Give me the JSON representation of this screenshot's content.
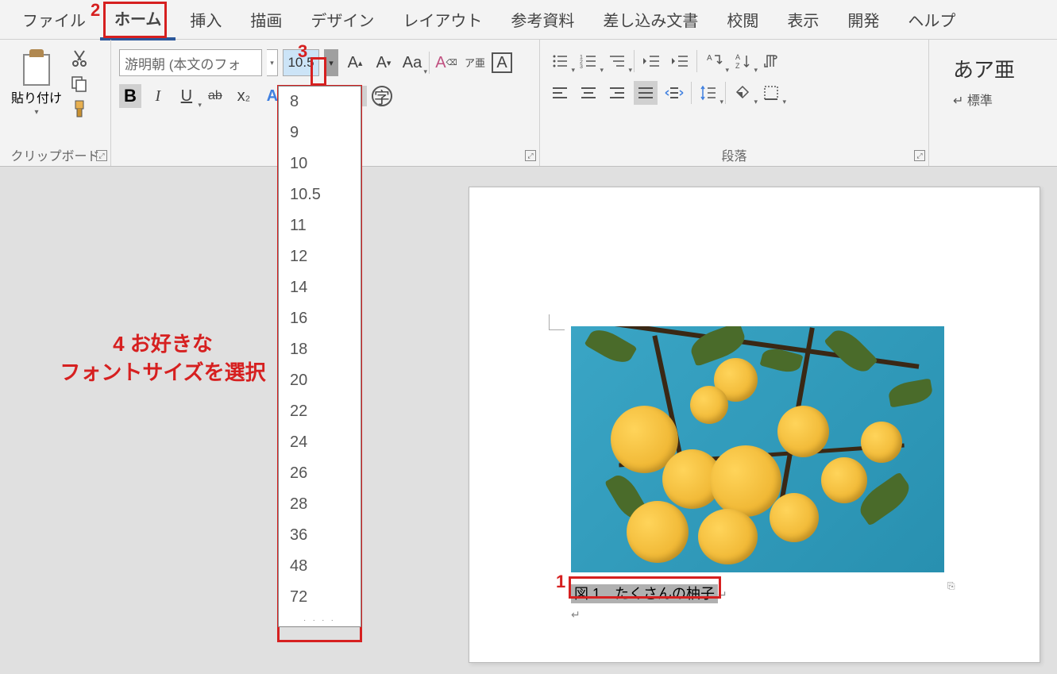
{
  "menu": {
    "items": [
      "ファイル",
      "ホーム",
      "挿入",
      "描画",
      "デザイン",
      "レイアウト",
      "参考資料",
      "差し込み文書",
      "校閲",
      "表示",
      "開発",
      "ヘルプ"
    ],
    "active_index": 1
  },
  "ribbon": {
    "clipboard": {
      "paste": "貼り付け",
      "group_label": "クリップボード"
    },
    "font": {
      "name": "游明朝 (本文のフォ",
      "size": "10.5",
      "bold": "B",
      "italic": "I",
      "underline": "U",
      "strike": "ab",
      "change_case": "Aa",
      "phonetic": "ア亜",
      "char_border": "A"
    },
    "paragraph": {
      "group_label": "段落"
    },
    "styles": {
      "sample": "あア亜",
      "normal": "標準"
    }
  },
  "font_size_dropdown": {
    "options": [
      "8",
      "9",
      "10",
      "10.5",
      "11",
      "12",
      "14",
      "16",
      "18",
      "20",
      "22",
      "24",
      "26",
      "28",
      "36",
      "48",
      "72"
    ]
  },
  "document": {
    "caption": "図 1　たくさんの柚子"
  },
  "callouts": {
    "c1": "1",
    "c2": "2",
    "c3": "3",
    "c4_num": "4",
    "c4_text": "お好きな\nフォントサイズを選択"
  }
}
